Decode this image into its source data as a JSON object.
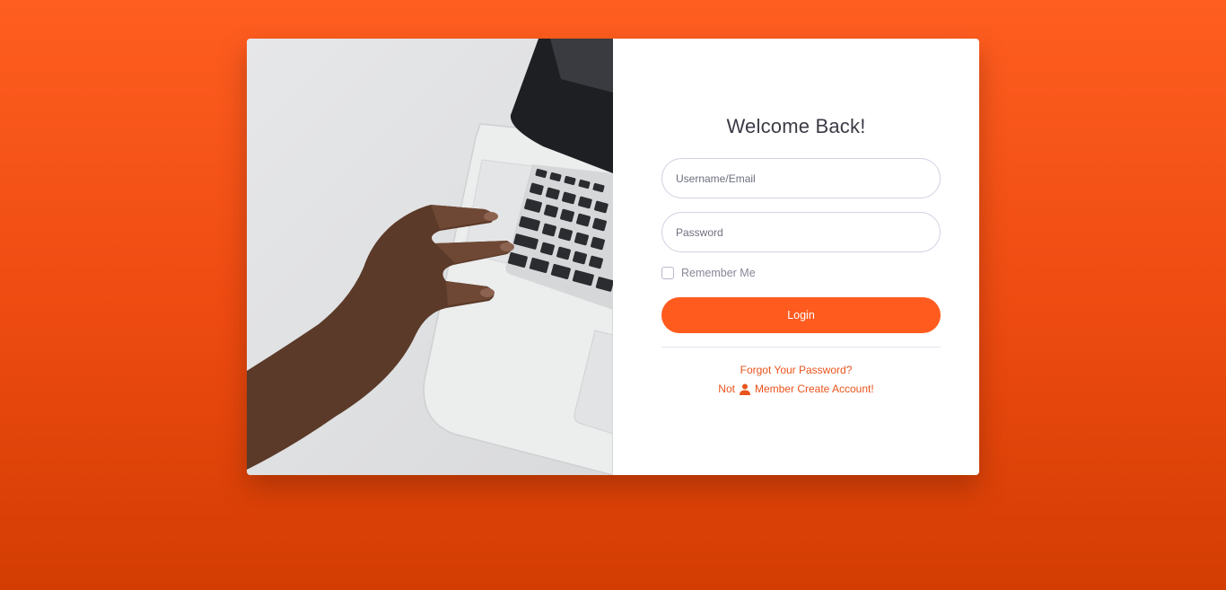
{
  "login": {
    "title": "Welcome Back!",
    "username_placeholder": "Username/Email",
    "password_placeholder": "Password",
    "remember_label": "Remember Me",
    "remember_checked": false,
    "login_label": "Login",
    "forgot_label": "Forgot Your Password?",
    "create_prefix": "Not",
    "create_icon": "user-icon",
    "create_suffix": "Member Create Account!"
  },
  "image": {
    "subject": "hand-on-laptop-keyboard-photo"
  },
  "colors": {
    "accent": "#ff5b1f",
    "link": "#e9531c",
    "background_top": "#ff5e20",
    "background_bottom": "#d33d02"
  }
}
